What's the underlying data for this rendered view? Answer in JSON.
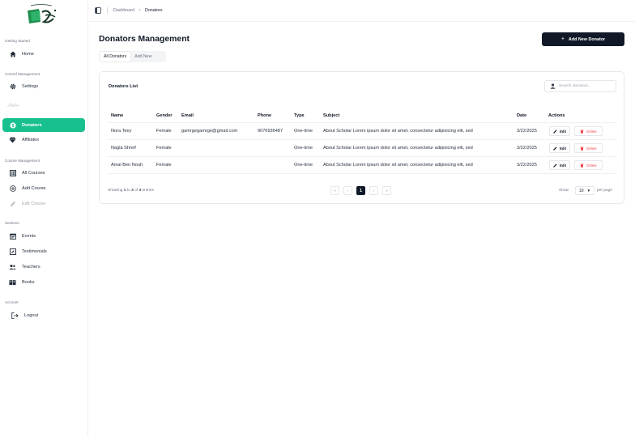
{
  "sidebar": {
    "sections": {
      "getting_started": "Getting Started",
      "control_management": "Control Management",
      "course_management": "Course Management",
      "sections": "Sections",
      "account": "Account"
    },
    "items": {
      "home": "Home",
      "settings": "Settings",
      "blurred": "سكولار",
      "donators": "Donators",
      "affiliates": "Affiliates",
      "all_courses": "All Courses",
      "add_course": "Add Course",
      "edit_course": "Edit Course",
      "events": "Events",
      "testimonials": "Testimonials",
      "teachers": "Teachers",
      "books": "Books",
      "logout": "Logout"
    },
    "accent_color": "#18c08f"
  },
  "topbar": {
    "breadcrumb_root": "Dashboard",
    "breadcrumb_current": "Donators"
  },
  "page": {
    "title": "Donators Management",
    "add_button": "Add New Donator",
    "tabs": [
      "All Donators",
      "Add New"
    ]
  },
  "card": {
    "title": "Donators List",
    "search_placeholder": "Search donators..."
  },
  "table": {
    "headers": [
      "Name",
      "Gender",
      "Email",
      "Phone",
      "Type",
      "Subject",
      "Date",
      "Actions"
    ],
    "rows": [
      [
        "Nora Teey",
        "Female",
        "gamrgegamrge@gmail.com",
        "9076936487",
        "One-time",
        "About Scholar Lorem ipsum dolor sit amet, consectetur adipisicing elit, sed",
        "3/22/2025"
      ],
      [
        "Nagla Shreif",
        "Female",
        "",
        "",
        "One-time",
        "About Scholar Lorem ipsum dolor sit amet, consectetur adipisicing elit, sed",
        "3/22/2025"
      ],
      [
        "Amal Ben Nouh",
        "Female",
        "",
        "",
        "One-time",
        "About Scholar Lorem ipsum dolor sit amet, consectetur adipisicing elit, sed",
        "3/22/2025"
      ]
    ],
    "edit_label": "Edit",
    "delete_label": "Delete"
  },
  "footer": {
    "showing_prefix": "Showing",
    "from": "1",
    "to_word": "to",
    "to": "3",
    "of_word": "of",
    "total": "3",
    "entries_word": "entries",
    "first": "«",
    "prev": "‹",
    "current_page": "1",
    "next": "›",
    "last": "»",
    "show_label": "Show",
    "per_page_value": "10",
    "per_page_suffix": "per page"
  }
}
